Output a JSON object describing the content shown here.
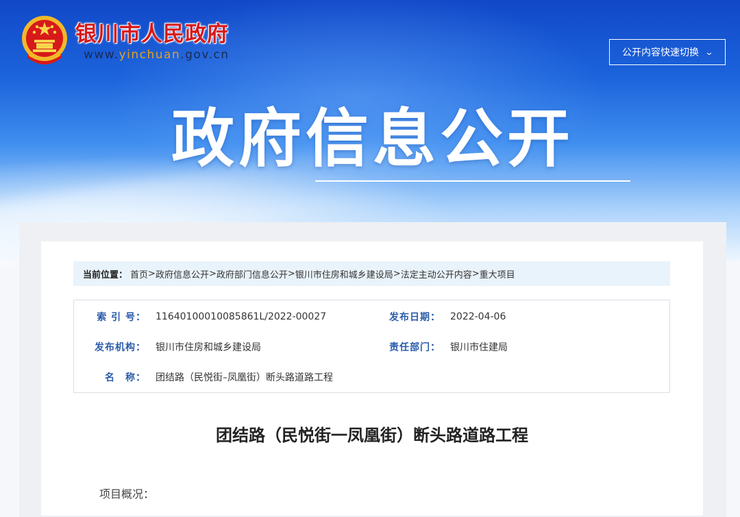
{
  "header": {
    "site_name": "银川市人民政府",
    "url_prefix": "www.",
    "url_highlight": "yinchuan",
    "url_suffix": ".gov.cn",
    "switch_label": "公开内容快速切换",
    "banner_title": "政府信息公开"
  },
  "breadcrumb": {
    "label": "当前位置：",
    "items": [
      "首页",
      "政府信息公开",
      "政府部门信息公开",
      "银川市住房和城乡建设局",
      "法定主动公开内容",
      "重大项目"
    ],
    "separator": ">"
  },
  "meta": {
    "index_label": "索 引 号：",
    "index_value": "11640100010085861L/2022-00027",
    "date_label": "发布日期：",
    "date_value": "2022-04-06",
    "org_label": "发布机构：",
    "org_value": "银川市住房和城乡建设局",
    "dept_label": "责任部门：",
    "dept_value": "银川市住建局",
    "name_label": "名　称：",
    "name_value": "团结路（民悦街–凤凰街）断头路道路工程"
  },
  "document": {
    "title": "团结路（民悦街一凤凰街）断头路道路工程",
    "section": "项目概况："
  },
  "colors": {
    "brand_red": "#d7191a",
    "banner_blue": "#1c64dc",
    "label_blue": "#2a5caa",
    "crumb_bg": "#e9f3fb"
  },
  "icons": {
    "emblem": "national-emblem-icon",
    "dropdown": "chevron-down-icon"
  }
}
